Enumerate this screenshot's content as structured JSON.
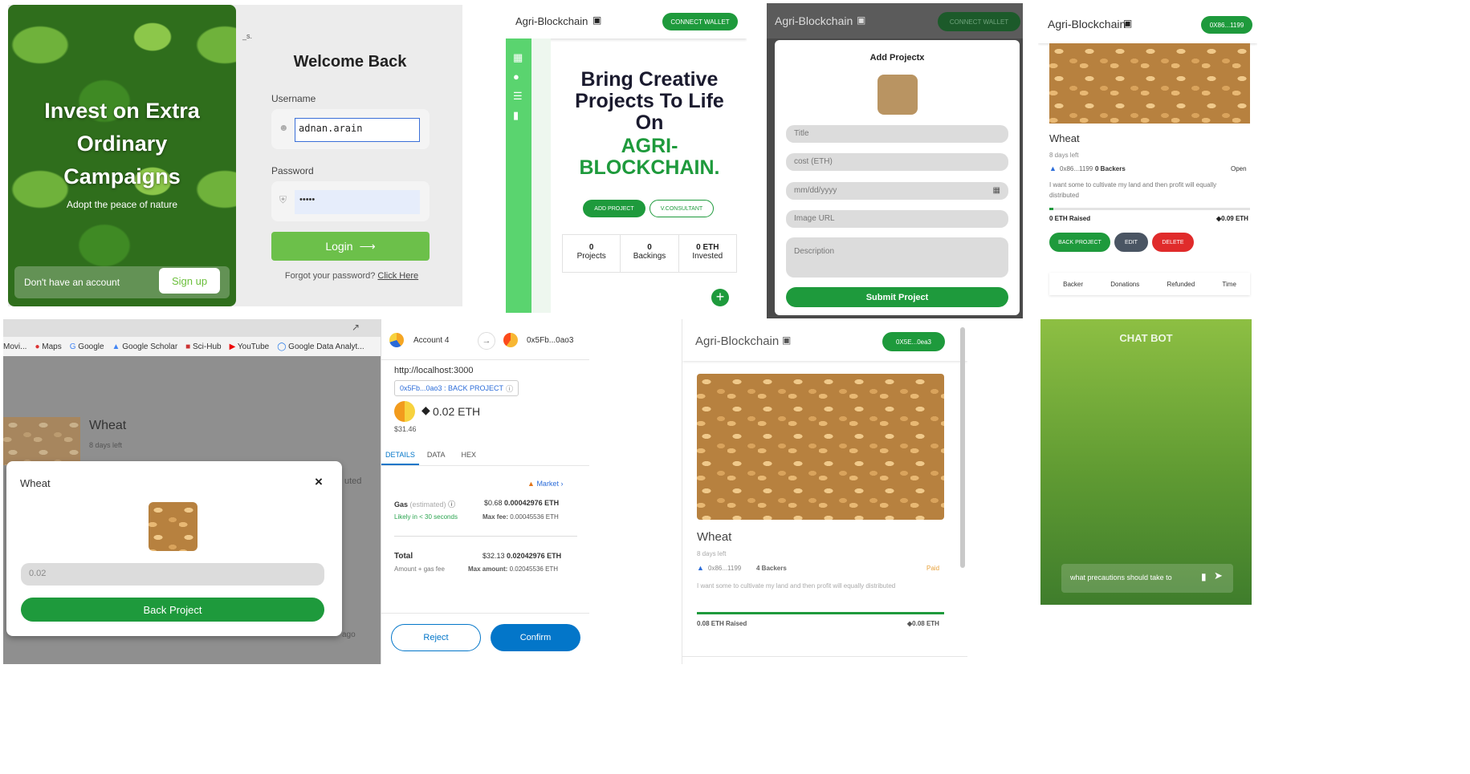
{
  "login": {
    "hero_title": "Invest on Extra Ordinary Campaigns",
    "hero_sub": "Adopt the peace of nature",
    "no_account": "Don't have an account",
    "signup": "Sign up",
    "welcome": "Welcome Back",
    "username_label": "Username",
    "username_value": "adnan.arain",
    "password_label": "Password",
    "password_value": "•••••",
    "login_btn": "Login",
    "forgot": "Forgot your password?",
    "click_here": "Click Here",
    "corner_mark": "_s."
  },
  "home": {
    "brand": "Agri-Blockchain",
    "connect": "CONNECT WALLET",
    "headline": "Bring Creative Projects To Life On",
    "headline_accent": "AGRI-BLOCKCHAIN.",
    "add_project": "ADD PROJECT",
    "consultant": "V.CONSULTANT",
    "stats": [
      {
        "value": "0",
        "label": "Projects"
      },
      {
        "value": "0",
        "label": "Backings"
      },
      {
        "value": "0 ETH",
        "label": "Invested"
      }
    ]
  },
  "add_project": {
    "brand": "Agri-Blockchain",
    "connect": "CONNECT WALLET",
    "title": "Add Project",
    "close": "x",
    "fields": [
      "Title",
      "cost (ETH)",
      "mm/dd/yyyy",
      "Image URL",
      "Description"
    ],
    "submit": "Submit Project"
  },
  "detail": {
    "brand": "Agri-Blockchain",
    "wallet": "0X86...1199",
    "name": "Wheat",
    "days_left": "8 days left",
    "owner": "0x86...1199",
    "backers": "0 Backers",
    "status": "Open",
    "description": "I want some to cultivate my land and then profit will equally distributed",
    "raised": "0 ETH Raised",
    "target": "0.09 ETH",
    "progress": 0.02,
    "back_btn": "BACK PROJECT",
    "edit_btn": "EDIT",
    "delete_btn": "DELETE",
    "columns": [
      "Backer",
      "Donations",
      "Refunded",
      "Time"
    ]
  },
  "back_modal": {
    "bookmarks": [
      "Movi...",
      "Maps",
      "Google",
      "Google Scholar",
      "Sci-Hub",
      "YouTube",
      "Google Data Analyt..."
    ],
    "bg_name": "Wheat",
    "bg_days": "8 days left",
    "bg_fragment": "uted",
    "modal_title": "Wheat",
    "close": "×",
    "amount": "0.02",
    "back_btn": "Back Project",
    "bg_bottom": "ago"
  },
  "metamask": {
    "account_from": "Account 4",
    "account_to": "0x5Fb...0ao3",
    "origin": "http://localhost:3000",
    "method_tag": "0x5Fb...0ao3 : BACK PROJECT",
    "amount": "0.02 ETH",
    "usd": "$31.46",
    "tabs": [
      "DETAILS",
      "DATA",
      "HEX"
    ],
    "market": "Market",
    "gas_label": "Gas",
    "gas_estimated": "(estimated)",
    "gas_usd": "$0.68",
    "gas_eth": "0.00042976 ETH",
    "likely": "Likely in < 30 seconds",
    "max_fee_label": "Max fee:",
    "max_fee": "0.00045536 ETH",
    "total_label": "Total",
    "total_usd": "$32.13",
    "total_eth": "0.02042976 ETH",
    "amount_gas": "Amount + gas fee",
    "max_amount_label": "Max amount:",
    "max_amount": "0.02045536 ETH",
    "reject": "Reject",
    "confirm": "Confirm"
  },
  "funded": {
    "brand": "Agri-Blockchain",
    "wallet": "0X5E...0ea3",
    "name": "Wheat",
    "days_left": "8 days left",
    "owner": "0x86...1199",
    "backers": "4 Backers",
    "status": "Paid",
    "description": "I want some to cultivate my land and then profit will equally distributed",
    "raised": "0.08 ETH Raised",
    "target": "0.08 ETH",
    "progress": 1.0
  },
  "chatbot": {
    "title": "CHAT BOT",
    "input": "what precautions should take to"
  },
  "colors": {
    "green": "#1e9a3c",
    "sidebar_green": "#5ad46f",
    "delete_red": "#e02b2b",
    "edit_grey": "#4a5563",
    "metamask_blue": "#0376c9"
  }
}
